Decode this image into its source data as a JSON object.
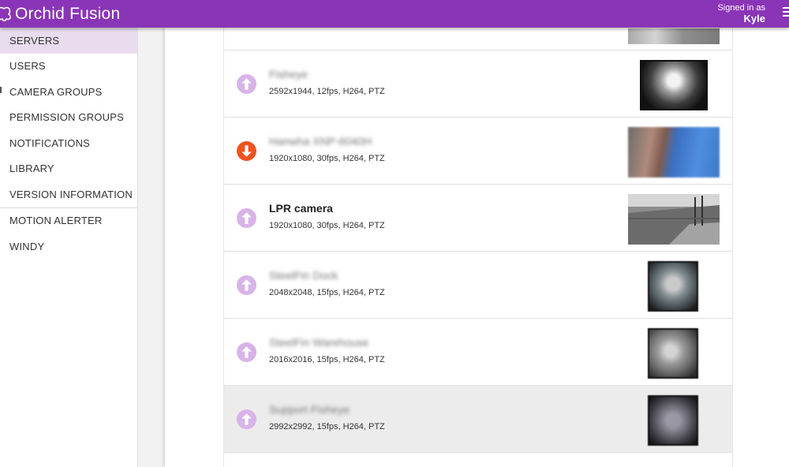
{
  "app": {
    "brand": "Orchid Fusion",
    "signed_in_label": "Signed in as",
    "user_name": "Kyle",
    "accent_color": "#8a35b7"
  },
  "sidebar": {
    "items": [
      {
        "label": "SERVERS",
        "active": true
      },
      {
        "label": "USERS"
      },
      {
        "label": "CAMERA GROUPS"
      },
      {
        "label": "PERMISSION GROUPS"
      },
      {
        "label": "NOTIFICATIONS"
      },
      {
        "label": "LIBRARY"
      },
      {
        "label": "VERSION INFORMATION"
      },
      {
        "label": "MOTION ALERTER"
      },
      {
        "label": "WINDY"
      }
    ]
  },
  "cameras": [
    {
      "name": "Fisheye",
      "specs": "2592x1944, 12fps, H264, PTZ",
      "status": "up-icon",
      "name_obscured": true
    },
    {
      "name": "Hanwha XNP-6040H",
      "specs": "1920x1080, 30fps, H264, PTZ",
      "status": "down-icon",
      "name_obscured": true
    },
    {
      "name": "LPR camera",
      "specs": "1920x1080, 30fps, H264, PTZ",
      "status": "up-icon",
      "name_obscured": false
    },
    {
      "name": "SteelFin Dock",
      "specs": "2048x2048, 15fps, H264, PTZ",
      "status": "up-icon",
      "name_obscured": true
    },
    {
      "name": "SteelFin Warehouse",
      "specs": "2016x2016, 15fps, H264, PTZ",
      "status": "up-icon",
      "name_obscured": true
    },
    {
      "name": "Support Fisheye",
      "specs": "2992x2992, 15fps, H264, PTZ",
      "status": "up-icon",
      "name_obscured": true
    }
  ],
  "colors": {
    "status_up": "#d8b3e8",
    "status_down": "#f0521e"
  }
}
